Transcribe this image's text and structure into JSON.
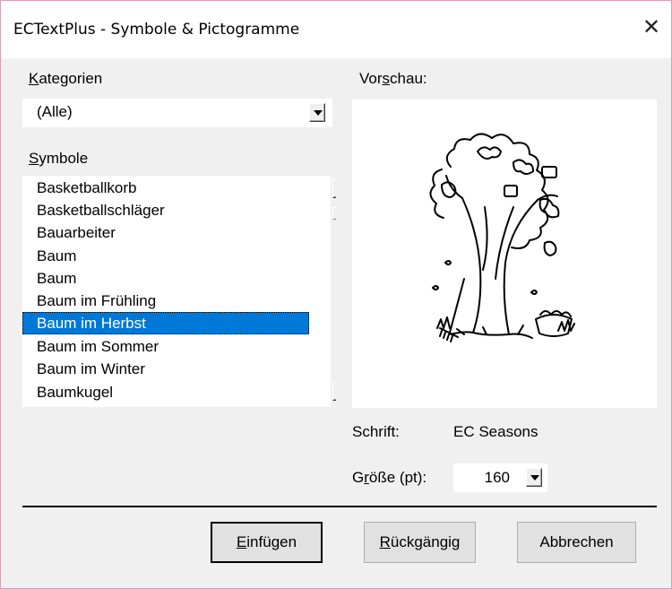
{
  "window": {
    "title": "ECTextPlus - Symbole & Pictogramme",
    "close_glyph": "✕"
  },
  "kategorien": {
    "label_first": "K",
    "label_rest": "ategorien",
    "selected": "(Alle)"
  },
  "symbole": {
    "label_first": "S",
    "label_rest": "ymbole",
    "items": [
      {
        "label": "Basketballkorb",
        "selected": false
      },
      {
        "label": "Basketballschläger",
        "selected": false
      },
      {
        "label": "Bauarbeiter",
        "selected": false
      },
      {
        "label": "Baum",
        "selected": false
      },
      {
        "label": "Baum",
        "selected": false
      },
      {
        "label": "Baum im Frühling",
        "selected": false
      },
      {
        "label": "Baum im Herbst",
        "selected": true
      },
      {
        "label": "Baum im Sommer",
        "selected": false
      },
      {
        "label": "Baum im Winter",
        "selected": false
      },
      {
        "label": "Baumkugel",
        "selected": false
      }
    ]
  },
  "vorschau": {
    "label_a": "Vor",
    "label_u": "s",
    "label_b": "chau:",
    "image": "tree-in-autumn-icon"
  },
  "schrift": {
    "label": "Schrift:",
    "value": "EC Seasons"
  },
  "groesse": {
    "label_a": "G",
    "label_u": "r",
    "label_b": "öße (pt):",
    "value": "160"
  },
  "buttons": {
    "insert_u": "E",
    "insert_rest": "infügen",
    "undo_u": "R",
    "undo_rest": "ückgängig",
    "cancel": "Abbrechen"
  },
  "colors": {
    "selection": "#0078d7",
    "window_border": "#d9a0b8",
    "dialog_bg": "#f0f0f0"
  }
}
